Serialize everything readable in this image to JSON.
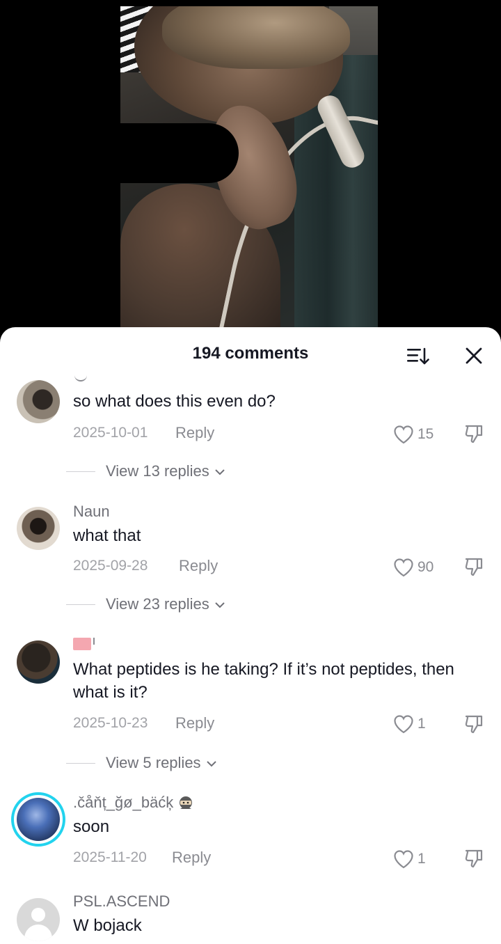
{
  "header": {
    "comment_count": "194 comments"
  },
  "comments": [
    {
      "username": "",
      "text": "so what does this even do?",
      "date": "2025-10-01",
      "reply_label": "Reply",
      "likes": "15",
      "replies_label": "View 13 replies"
    },
    {
      "username": "Naun",
      "text": "what that",
      "date": "2025-09-28",
      "reply_label": "Reply",
      "likes": "90",
      "replies_label": "View 23 replies"
    },
    {
      "username": "",
      "text": "What peptides is he taking? If it’s not peptides, then what is it?",
      "date": "2025-10-23",
      "reply_label": "Reply",
      "likes": "1",
      "replies_label": "View 5 replies"
    },
    {
      "username": ".čåňț_ğø_bäćķ",
      "text": "soon",
      "date": "2025-11-20",
      "reply_label": "Reply",
      "likes": "1"
    },
    {
      "username": "PSL.ASCEND",
      "text": "W bojack"
    }
  ],
  "colors": {
    "accent_ring": "#22d3ee",
    "text_primary": "#161823",
    "text_secondary": "#8a8b91"
  },
  "icons": [
    "sort-icon",
    "close-icon",
    "heart-icon",
    "dislike-icon",
    "chevron-down-icon"
  ]
}
